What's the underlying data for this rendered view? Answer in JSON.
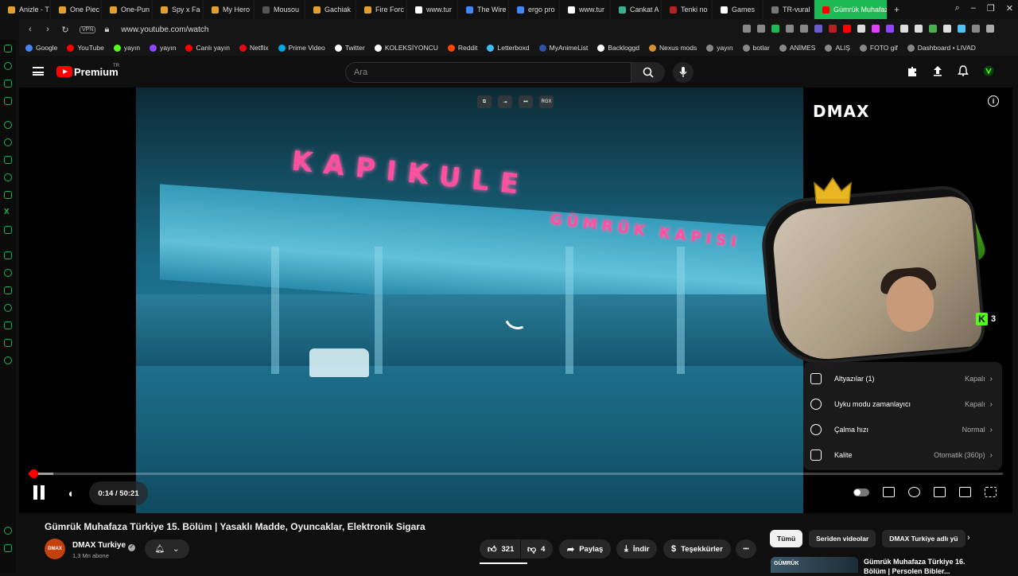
{
  "tabs": [
    {
      "label": "Anizle - T",
      "color": "#e0a030"
    },
    {
      "label": "One Piec",
      "color": "#e0a030"
    },
    {
      "label": "One-Pun",
      "color": "#e0a030"
    },
    {
      "label": "Spy x Fa",
      "color": "#e0a030"
    },
    {
      "label": "My Hero",
      "color": "#e0a030"
    },
    {
      "label": "Mousou",
      "color": "#555555"
    },
    {
      "label": "Gachiak",
      "color": "#e0a030"
    },
    {
      "label": "Fire Forc",
      "color": "#e0a030"
    },
    {
      "label": "www.tur",
      "color": "#ffffff"
    },
    {
      "label": "The Wire",
      "color": "#4285f4"
    },
    {
      "label": "ergo pro",
      "color": "#4285f4"
    },
    {
      "label": "www.tur",
      "color": "#ffffff"
    },
    {
      "label": "Cankat A",
      "color": "#3bb08f"
    },
    {
      "label": "Tenki no",
      "color": "#b22222"
    },
    {
      "label": "Games",
      "color": "#ffffff"
    },
    {
      "label": "TR-vural",
      "color": "#777777"
    }
  ],
  "active_tab": {
    "label": "Gümrük Muhafaza",
    "color": "#ff0000"
  },
  "addressbar": {
    "vpn": "VPN",
    "url": "www.youtube.com/watch"
  },
  "bookmarks": [
    {
      "label": "Google",
      "color": "#4285f4"
    },
    {
      "label": "YouTube",
      "color": "#ff0000"
    },
    {
      "label": "yayın",
      "color": "#53fc18"
    },
    {
      "label": "yayın",
      "color": "#9146ff"
    },
    {
      "label": "Canlı yayın",
      "color": "#ff0000"
    },
    {
      "label": "Netflix",
      "color": "#e50914"
    },
    {
      "label": "Prime Video",
      "color": "#00a8e1"
    },
    {
      "label": "Twitter",
      "color": "#ffffff"
    },
    {
      "label": "KOLEKSİYONCU",
      "color": "#ffffff"
    },
    {
      "label": "Reddit",
      "color": "#ff4500"
    },
    {
      "label": "Letterboxd",
      "color": "#40bcf4"
    },
    {
      "label": "MyAnimeList",
      "color": "#2e51a2"
    },
    {
      "label": "Backloggd",
      "color": "#ffffff"
    },
    {
      "label": "Nexus mods",
      "color": "#da8e35"
    },
    {
      "label": "yayın",
      "color": "#888888"
    },
    {
      "label": "botlar",
      "color": "#888888"
    },
    {
      "label": "ANİMES",
      "color": "#888888"
    },
    {
      "label": "ALIŞ",
      "color": "#888888"
    },
    {
      "label": "FOTO gif",
      "color": "#888888"
    },
    {
      "label": "Dashboard • LIVAD",
      "color": "#888888"
    }
  ],
  "youtube": {
    "logo_text": "Premium",
    "country": "TR",
    "search_placeholder": "Ara"
  },
  "video": {
    "sign_line1": "KAPIKULE",
    "sign_line2": "GÜMRÜK KAPISI",
    "top_control_label": "RGX",
    "channel_watermark": "DMAX",
    "kick_viewers": "3",
    "current_time": "0:14 / 50:21",
    "progress": 0.0046,
    "buffered": 0.025
  },
  "settings_menu": [
    {
      "label": "Altyazılar (1)",
      "value": "Kapalı",
      "icon": "subtitles-icon"
    },
    {
      "label": "Uyku modu zamanlayıcı",
      "value": "Kapalı",
      "icon": "sleep-timer-icon"
    },
    {
      "label": "Çalma hızı",
      "value": "Normal",
      "icon": "playback-speed-icon"
    },
    {
      "label": "Kalite",
      "value": "Otomatik (360p)",
      "icon": "quality-icon"
    }
  ],
  "watch": {
    "title": "Gümrük Muhafaza Türkiye 15. Bölüm | Yasaklı Madde, Oyuncaklar, Elektronik Sigara",
    "channel_avatar_text": "DMAX",
    "channel_name": "DMAX Turkiye",
    "subscribers": "1,3 Mn abone",
    "likes": "321",
    "dislikes": "4",
    "share": "Paylaş",
    "download": "İndir",
    "thanks": "Teşekkürler",
    "more": "•••"
  },
  "chips": {
    "all": "Tümü",
    "series": "Seriden videolar",
    "channel": "DMAX Turkiye adlı yü"
  },
  "recommendation": {
    "thumb_text": "GÜMRÜK",
    "title": "Gümrük Muhafaza Türkiye 16. Bölüm | Persolen Bibler..."
  }
}
